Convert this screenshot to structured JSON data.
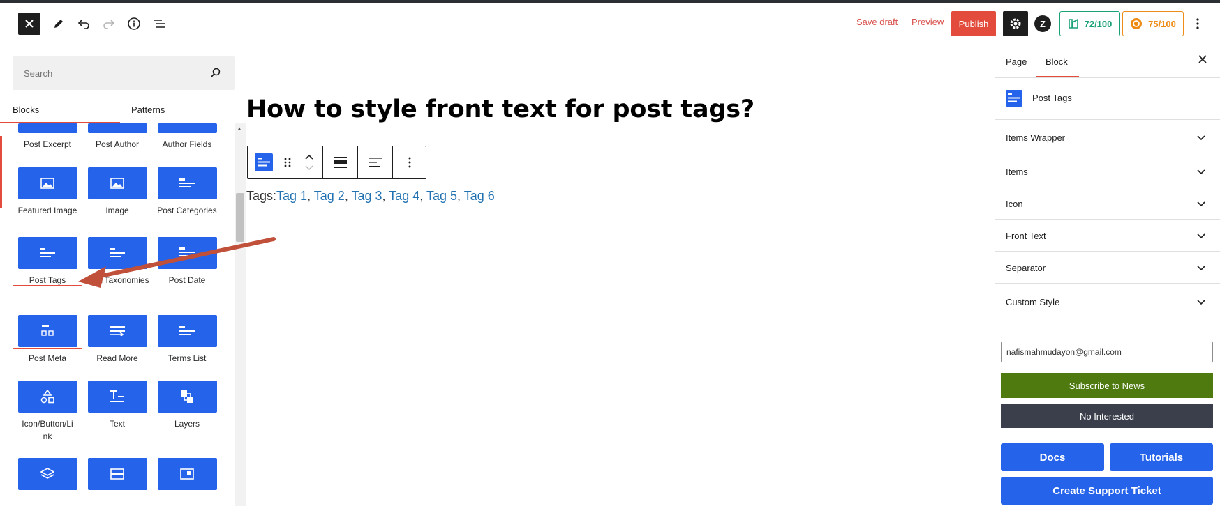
{
  "header": {
    "save_draft": "Save draft",
    "preview": "Preview",
    "publish": "Publish",
    "score_seo": "72/100",
    "score_read": "75/100",
    "z_icon": "Z"
  },
  "inserter": {
    "search_placeholder": "Search",
    "tabs": {
      "blocks": "Blocks",
      "patterns": "Patterns"
    },
    "partial_row": [
      "Post Excerpt",
      "Post Author",
      "Author Fields"
    ],
    "rows": [
      [
        "Featured Image",
        "Image",
        "Post Categories"
      ],
      [
        "Post Tags",
        "Post Taxonomies",
        "Post Date"
      ],
      [
        "Post Meta",
        "Read More",
        "Terms List"
      ],
      [
        "Icon/Button/Link",
        "Text",
        "Layers"
      ]
    ],
    "selected": "Post Tags"
  },
  "canvas": {
    "title": "How to style front text for post tags?",
    "tags_prefix": "Tags:",
    "tags": [
      "Tag 1",
      "Tag 2",
      "Tag 3",
      "Tag 4",
      "Tag 5",
      "Tag 6"
    ],
    "tag_separator": ", "
  },
  "sidebar": {
    "tabs": {
      "page": "Page",
      "block": "Block"
    },
    "block_name": "Post Tags",
    "panels": [
      "Items Wrapper",
      "Items",
      "Icon",
      "Front Text",
      "Separator",
      "Custom Style"
    ],
    "email": "nafismahmudayon@gmail.com",
    "subscribe": "Subscribe to News",
    "not_interested": "No Interested",
    "docs": "Docs",
    "tutorials": "Tutorials",
    "support": "Create Support Ticket"
  },
  "colors": {
    "accent": "#e34c3d",
    "block_blue": "#2563eb",
    "link": "#2271b1",
    "subscribe_green": "#4e7a10",
    "score_green": "#1aa179",
    "score_orange": "#ee8a12"
  }
}
